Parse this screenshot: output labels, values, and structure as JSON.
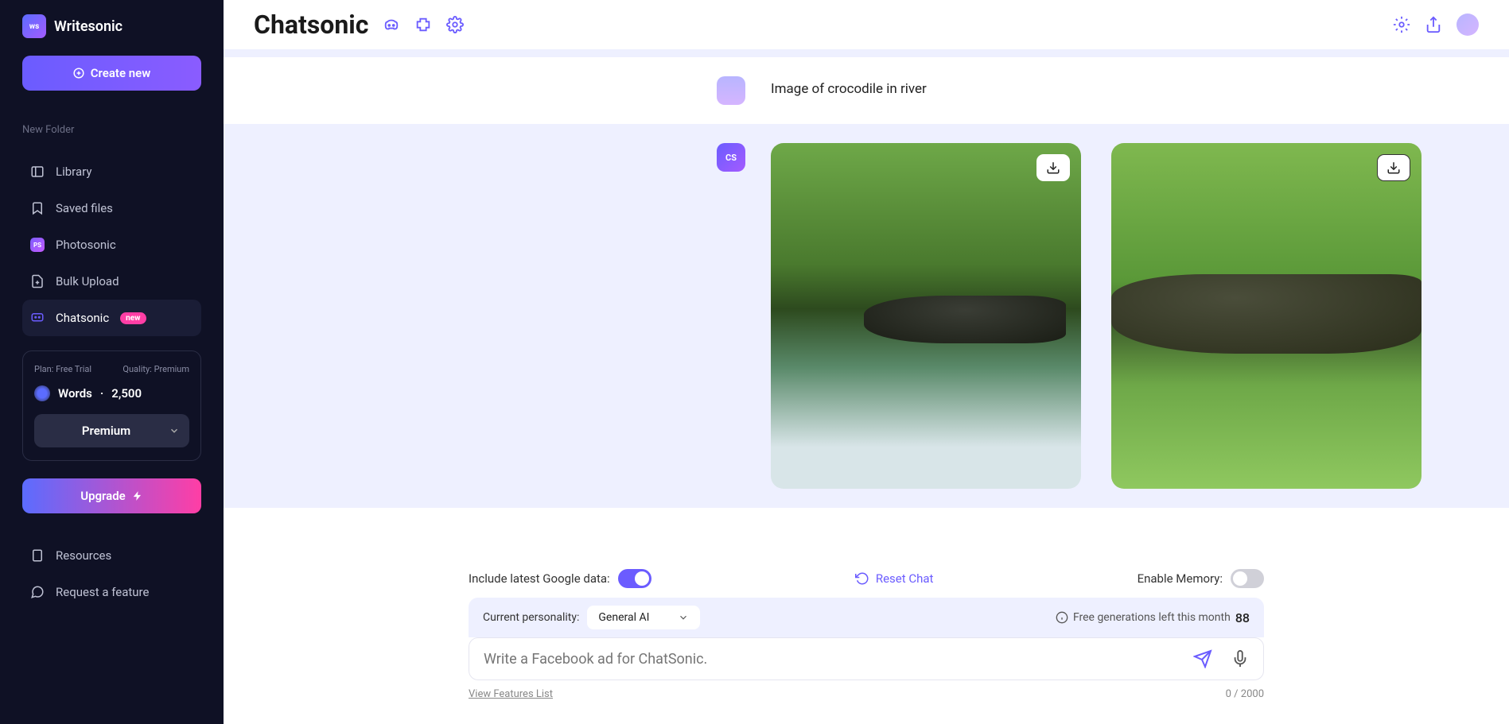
{
  "brand": "Writesonic",
  "page_title": "Chatsonic",
  "sidebar": {
    "create_label": "Create new",
    "new_folder": "New Folder",
    "items": [
      {
        "label": "Library"
      },
      {
        "label": "Saved files"
      },
      {
        "label": "Photosonic"
      },
      {
        "label": "Bulk Upload"
      },
      {
        "label": "Chatsonic",
        "badge": "new",
        "active": true
      }
    ],
    "plan": {
      "plan_label": "Plan: Free Trial",
      "quality_label": "Quality: Premium"
    },
    "words_label": "Words",
    "words_sep": "·",
    "words_value": "2,500",
    "premium_label": "Premium",
    "upgrade_label": "Upgrade",
    "bottom": [
      {
        "label": "Resources"
      },
      {
        "label": "Request a feature"
      }
    ]
  },
  "chat": {
    "user_msg": "Image of crocodile in river",
    "bot_badge": "CS"
  },
  "controls": {
    "google_label": "Include latest Google data:",
    "reset_label": "Reset Chat",
    "memory_label": "Enable Memory:",
    "personality_label": "Current personality:",
    "personality_value": "General AI",
    "gen_left_label": "Free generations left this month",
    "gen_left_value": "88",
    "placeholder": "Write a Facebook ad for ChatSonic.",
    "features_link": "View Features List",
    "char_counter": "0 / 2000"
  }
}
